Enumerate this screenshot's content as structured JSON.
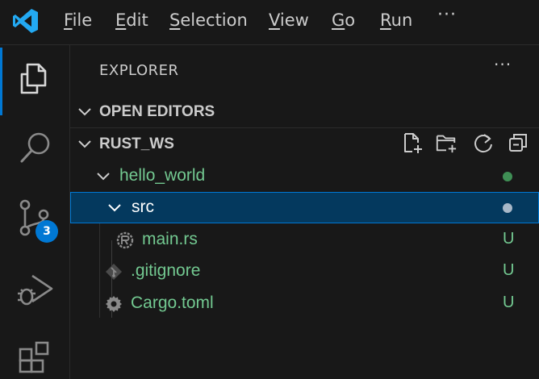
{
  "menu": {
    "file": "File",
    "edit": "Edit",
    "selection": "Selection",
    "view": "View",
    "go": "Go",
    "run": "Run",
    "more": "···"
  },
  "activity": {
    "items": [
      "explorer",
      "search",
      "source-control",
      "run-and-debug",
      "extensions"
    ],
    "active": "explorer",
    "scm_badge": "3"
  },
  "explorer": {
    "title": "EXPLORER",
    "more": "···",
    "open_editors": "OPEN EDITORS",
    "workspace": "RUST_WS",
    "tree": [
      {
        "name": "hello_world",
        "type": "folder",
        "status_color": "#3f8f55"
      },
      {
        "name": "src",
        "type": "folder",
        "selected": true,
        "status_color": "#a8b8c8"
      },
      {
        "name": "main.rs",
        "type": "file",
        "status": "U"
      },
      {
        "name": ".gitignore",
        "type": "file",
        "status": "U"
      },
      {
        "name": "Cargo.toml",
        "type": "file",
        "status": "U"
      }
    ]
  },
  "colors": {
    "accent": "#0078d4",
    "untracked": "#73c991",
    "selection_bg": "#04395e",
    "logo": "#23a9f2"
  }
}
